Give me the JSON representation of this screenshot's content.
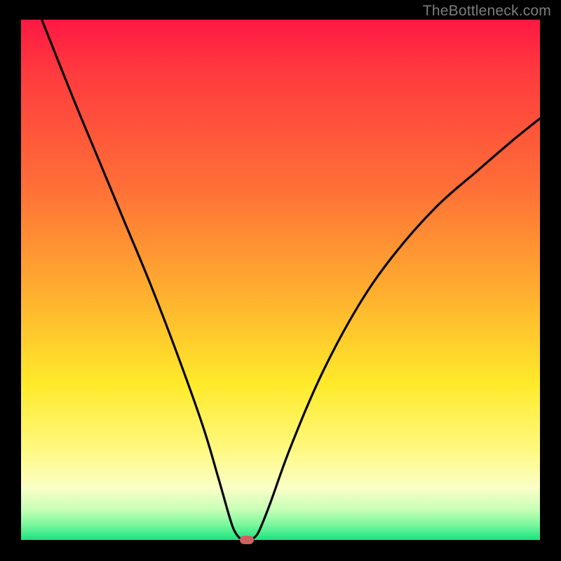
{
  "watermark": "TheBottleneck.com",
  "chart_data": {
    "type": "line",
    "title": "",
    "xlabel": "",
    "ylabel": "",
    "xlim": [
      0,
      100
    ],
    "ylim": [
      0,
      100
    ],
    "series": [
      {
        "name": "curve",
        "x": [
          4,
          10,
          15,
          20,
          25,
          30,
          35,
          38,
          40,
          41,
          42,
          43,
          44,
          45,
          46,
          48,
          52,
          58,
          65,
          72,
          80,
          88,
          95,
          100
        ],
        "values": [
          100,
          85,
          73,
          61,
          49,
          36,
          22,
          12,
          5,
          2,
          0.5,
          0,
          0,
          0.5,
          2,
          7,
          18,
          32,
          45,
          55,
          64,
          71,
          77,
          81
        ]
      }
    ],
    "marker": {
      "x": 43.5,
      "y": 0
    },
    "gradient_meaning": "top=red (bad), bottom=green (good)"
  }
}
